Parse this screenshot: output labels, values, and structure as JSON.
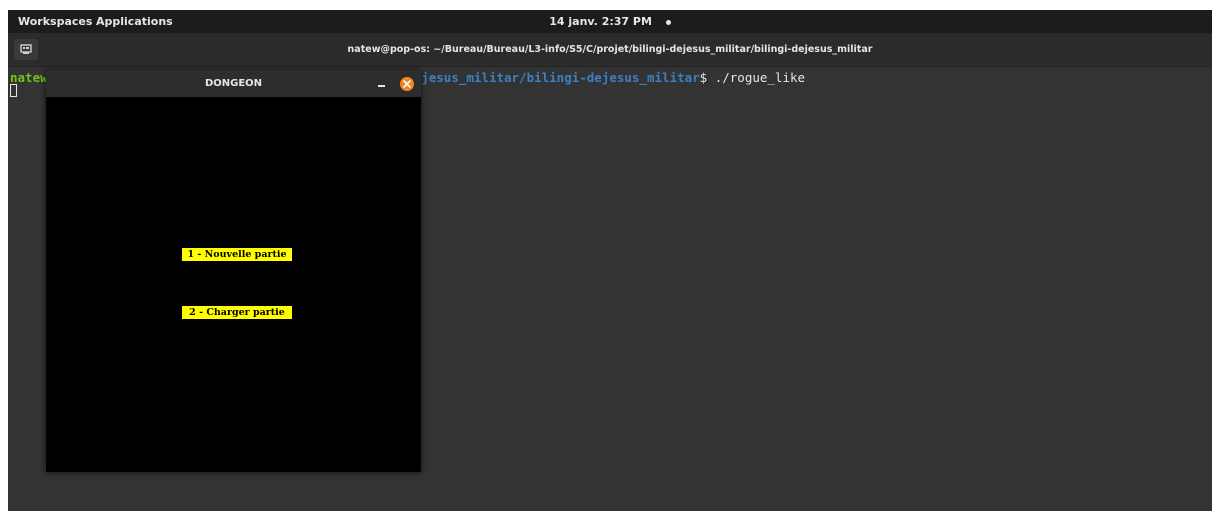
{
  "top_panel": {
    "workspaces": "Workspaces",
    "applications": "Applications",
    "clock": "14 janv.  2:37 PM"
  },
  "terminal": {
    "title": "natew@pop-os: ~/Bureau/Bureau/L3-info/S5/C/projet/bilingi-dejesus_militar/bilingi-dejesus_militar",
    "prompt_user": "natew",
    "prompt_path_visible": "-dejesus_militar/bilingi-dejesus_militar",
    "prompt_symbol": "$",
    "command": " ./rogue_like"
  },
  "game_window": {
    "title": "DONGEON",
    "menu": [
      {
        "label": "1 - Nouvelle partie"
      },
      {
        "label": "2 - Charger partie"
      }
    ]
  },
  "icons": {
    "terminal_tab": "terminal-icon",
    "minimize": "minimize-icon",
    "close": "close-icon",
    "notification": "notification-dot-icon"
  },
  "colors": {
    "prompt_user": "#73c214",
    "prompt_path": "#3e7fc2",
    "menu_highlight": "#ffff00",
    "close_button": "#f08522"
  }
}
